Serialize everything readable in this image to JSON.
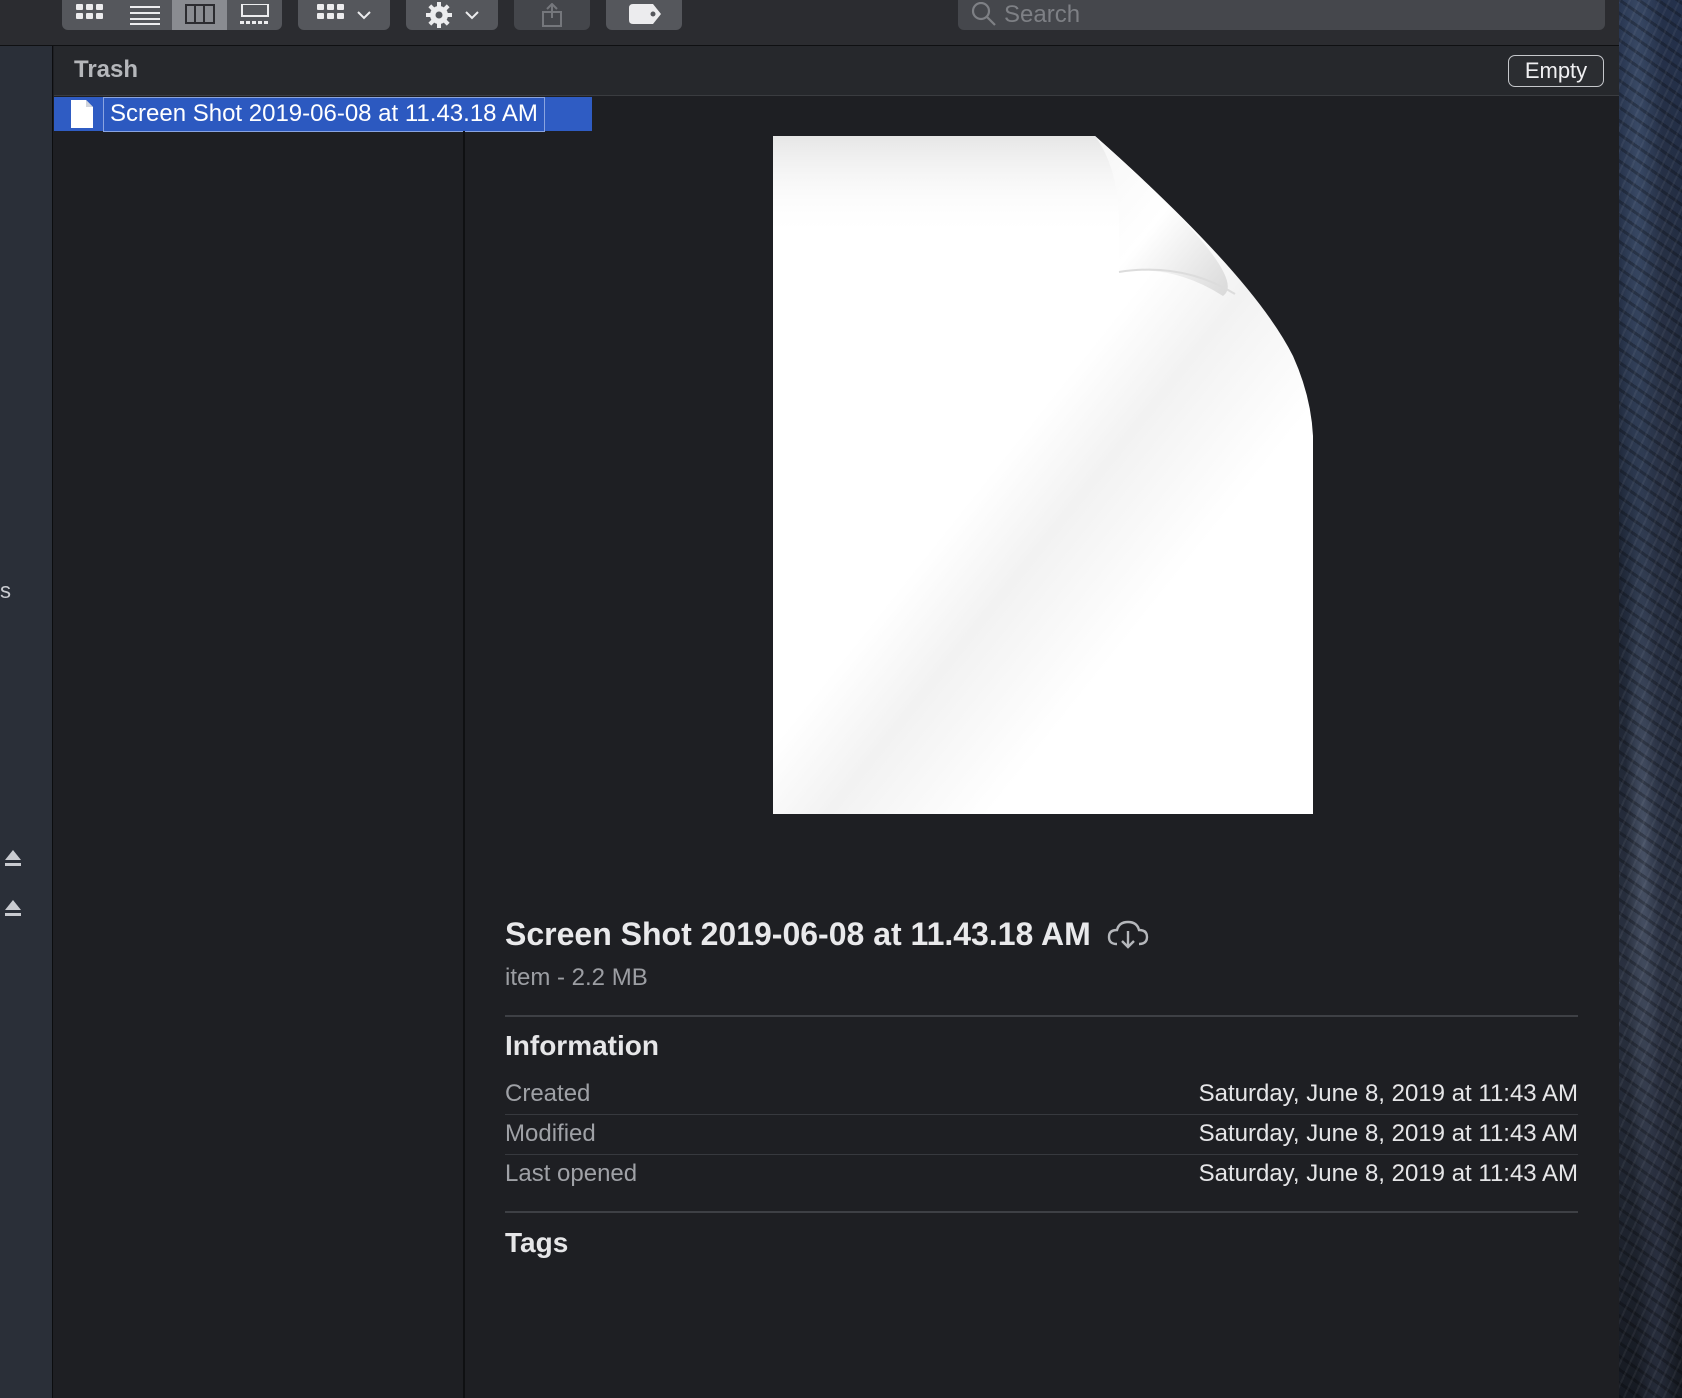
{
  "toolbar": {
    "view_buttons": [
      "icon-view-icon",
      "list-view-icon",
      "column-view-icon",
      "gallery-view-icon"
    ],
    "group_icon": "group-grid-icon",
    "action_icon": "gear-icon",
    "share_icon": "share-icon",
    "tag_icon": "tag-icon",
    "search_placeholder": "Search"
  },
  "sidebar": {
    "stray_glyph": "s"
  },
  "pathbar": {
    "title": "Trash",
    "empty_label": "Empty"
  },
  "file_list": {
    "selected_name": "Screen Shot 2019-06-08 at 11.43.18 AM"
  },
  "preview": {
    "title": "Screen Shot 2019-06-08 at 11.43.18 AM",
    "subtitle": "item - 2.2 MB",
    "information_heading": "Information",
    "info": [
      {
        "label": "Created",
        "value": "Saturday, June 8, 2019 at 11:43 AM"
      },
      {
        "label": "Modified",
        "value": "Saturday, June 8, 2019 at 11:43 AM"
      },
      {
        "label": "Last opened",
        "value": "Saturday, June 8, 2019 at 11:43 AM"
      }
    ],
    "tags_heading": "Tags"
  },
  "colors": {
    "selection": "#2f5cc3",
    "window_bg": "#1e1f23",
    "toolbar_bg": "#2b2c30"
  }
}
